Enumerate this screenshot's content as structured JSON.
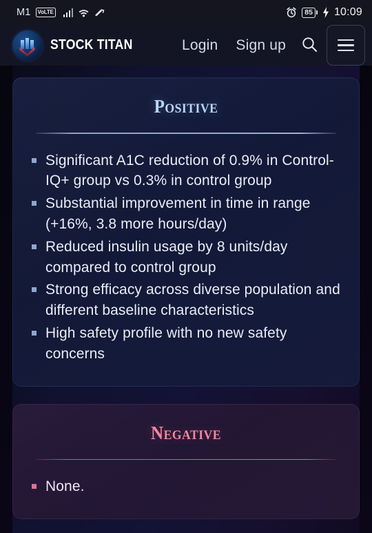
{
  "status_bar": {
    "carrier": "M1",
    "network_badge": "VoLTE",
    "signal_icon": "signal-bars-icon",
    "wifi_icon": "wifi-icon",
    "vpn_icon": "vpn-key-icon",
    "alarm_icon": "alarm-clock-icon",
    "battery_level": "85",
    "charging_icon": "charging-bolt-icon",
    "time": "10:09"
  },
  "header": {
    "logo_icon": "stock-titan-logo-icon",
    "brand_name": "STOCK TITAN",
    "login_label": "Login",
    "signup_label": "Sign up",
    "search_icon": "search-icon",
    "menu_icon": "hamburger-menu-icon"
  },
  "cards": {
    "positive": {
      "title": "Positive",
      "accent_color": "#bcd6f5",
      "bullets": [
        "Significant A1C reduction of 0.9% in Control-IQ+ group vs 0.3% in control group",
        "Substantial improvement in time in range (+16%, 3.8 more hours/day)",
        "Reduced insulin usage by 8 units/day compared to control group",
        "Strong efficacy across diverse population and different baseline characteristics",
        "High safety profile with no new safety concerns"
      ]
    },
    "negative": {
      "title": "Negative",
      "accent_color": "#f4879f",
      "bullets": [
        "None."
      ]
    }
  }
}
